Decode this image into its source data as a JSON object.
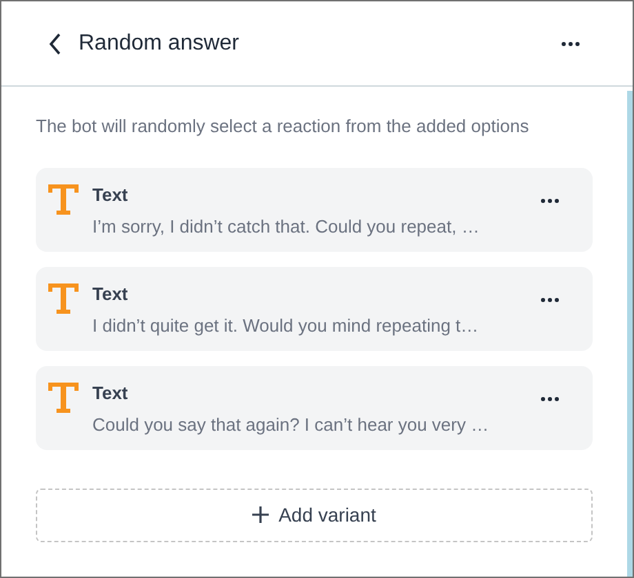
{
  "header": {
    "title": "Random answer"
  },
  "description": "The bot will randomly select a reaction from the added options",
  "variants": [
    {
      "kind": "text",
      "label": "Text",
      "preview": "I’m sorry, I didn’t catch that. Could you repeat, …"
    },
    {
      "kind": "text",
      "label": "Text",
      "preview": "I didn’t quite get it. Would you mind repeating t…"
    },
    {
      "kind": "text",
      "label": "Text",
      "preview": "Could you say that again? I can’t hear you very …"
    }
  ],
  "add_button": {
    "label": "Add variant"
  }
}
